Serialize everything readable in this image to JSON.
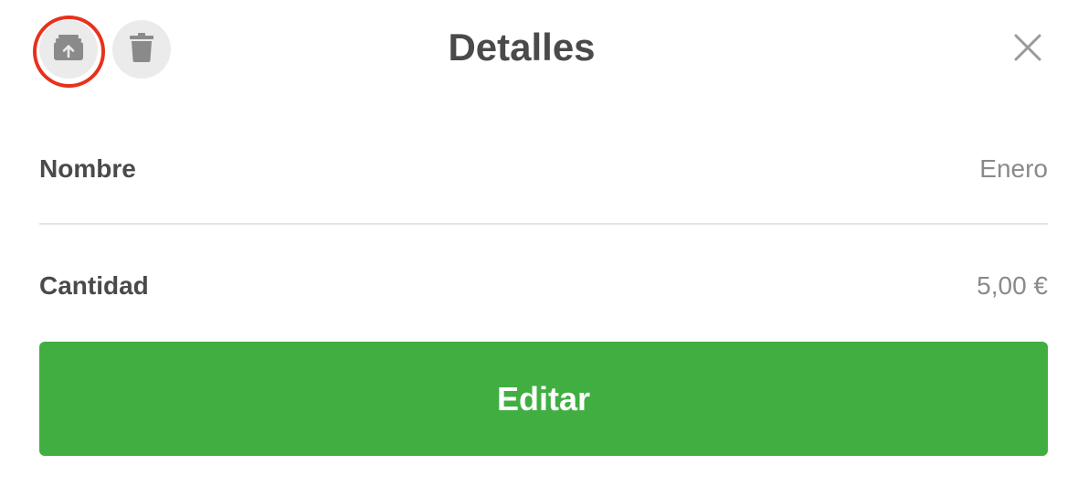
{
  "dialog": {
    "title": "Detalles",
    "icons": {
      "unarchive": "archive-upload-icon",
      "delete": "trash-icon",
      "close": "close-icon"
    },
    "highlight_color": "#e8311d"
  },
  "fields": {
    "name": {
      "label": "Nombre",
      "value": "Enero"
    },
    "amount": {
      "label": "Cantidad",
      "value": "5,00 €"
    }
  },
  "actions": {
    "edit_label": "Editar",
    "edit_color": "#41ae42"
  }
}
